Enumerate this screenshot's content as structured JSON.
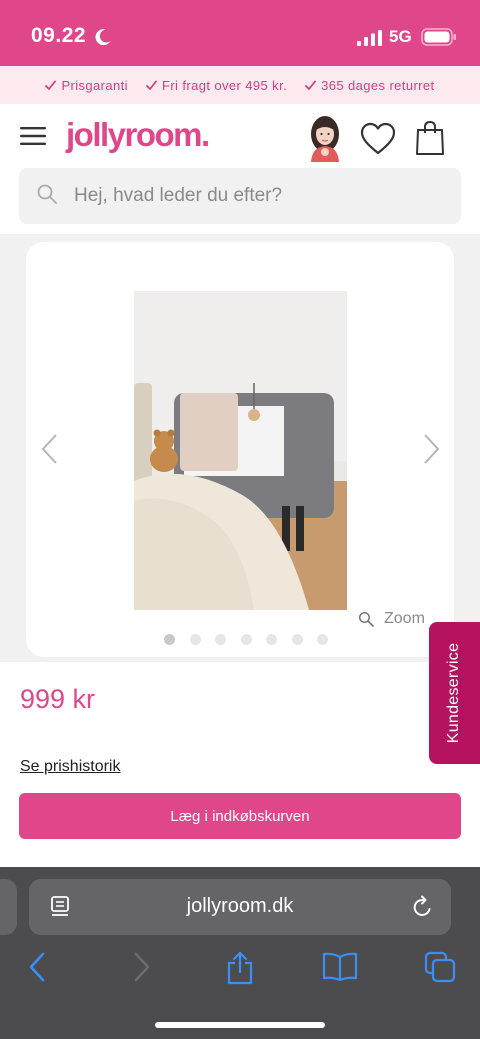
{
  "status_bar": {
    "time": "09.22",
    "network": "5G"
  },
  "usp": [
    {
      "label": "Prisgaranti"
    },
    {
      "label": "Fri fragt over 495 kr."
    },
    {
      "label": "365 dages returret"
    }
  ],
  "header": {
    "logo": "jollyroom."
  },
  "search": {
    "placeholder": "Hej, hvad leder du efter?"
  },
  "gallery": {
    "zoom_label": "Zoom",
    "image_count": 7,
    "active_index": 0
  },
  "service_tab": {
    "label": "Kundeservice"
  },
  "product": {
    "price": "999 kr",
    "price_history_label": "Se prishistorik",
    "add_to_cart_label": "Læg i indkøbskurven"
  },
  "browser": {
    "url": "jollyroom.dk"
  },
  "colors": {
    "brand": "#e0478a",
    "service": "#b5135f",
    "browser_bg": "#4c4c4e",
    "ios_blue": "#3a8ef6"
  }
}
